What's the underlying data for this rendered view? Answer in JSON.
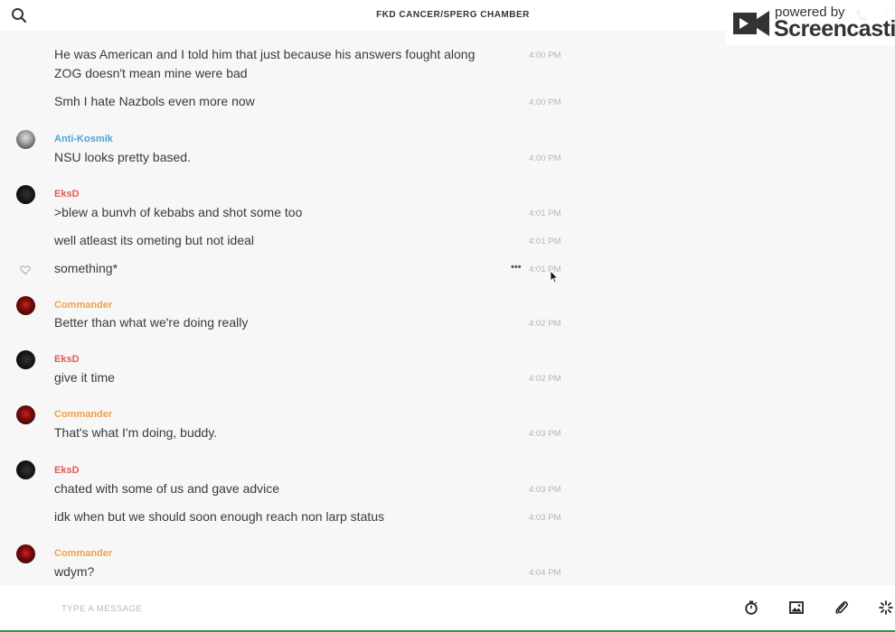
{
  "header": {
    "title": "FKD CANCER/SPERG CHAMBER"
  },
  "watermark": {
    "powered_by": "powered by",
    "brand": "Screencastify"
  },
  "messages": [
    {
      "author": "",
      "text": "He was American and I told him that just because his answers fought along",
      "text2": "ZOG doesn't mean mine were bad",
      "time": "4:00 PM"
    },
    {
      "author": "",
      "text": "Smh I hate Nazbols even more now",
      "time": "4:00 PM"
    },
    {
      "author": "Anti-Kosmik",
      "text": "NSU looks pretty based.",
      "time": "4:00 PM"
    },
    {
      "author": "EksD",
      "text": ">blew a bunvh of kebabs and shot some too",
      "time": "4:01 PM"
    },
    {
      "author": "",
      "text": "well atleast its ometing but not ideal",
      "time": "4:01 PM"
    },
    {
      "author": "",
      "text": "something*",
      "time": "4:01 PM"
    },
    {
      "author": "Commander",
      "text": "Better than what we're doing really",
      "time": "4:02 PM"
    },
    {
      "author": "EksD",
      "text": "give it time",
      "time": "4:02 PM"
    },
    {
      "author": "Commander",
      "text": "That's what I'm doing, buddy.",
      "time": "4:03 PM"
    },
    {
      "author": "EksD",
      "text": "chated with some of us and gave advice",
      "time": "4:03 PM"
    },
    {
      "author": "",
      "text": "idk when but we should soon enough reach non larp status",
      "time": "4:03 PM"
    },
    {
      "author": "Commander",
      "text": "wdym?",
      "time": "4:04 PM"
    }
  ],
  "hover_actions": {
    "more": "•••"
  },
  "composer": {
    "placeholder": "TYPE A MESSAGE"
  },
  "colors": {
    "anti_kosmik": "#4aa3d6",
    "eksd": "#e25a57",
    "commander": "#f0a14a",
    "timestamp": "#b5b5b5",
    "bottom_border": "#2e9b3c"
  },
  "icons": [
    "search-icon",
    "phone-icon",
    "info-icon",
    "heart-icon",
    "more-icon",
    "timer-icon",
    "image-icon",
    "paperclip-icon",
    "sparkle-icon",
    "screencastify-logo-icon",
    "cursor-icon"
  ]
}
